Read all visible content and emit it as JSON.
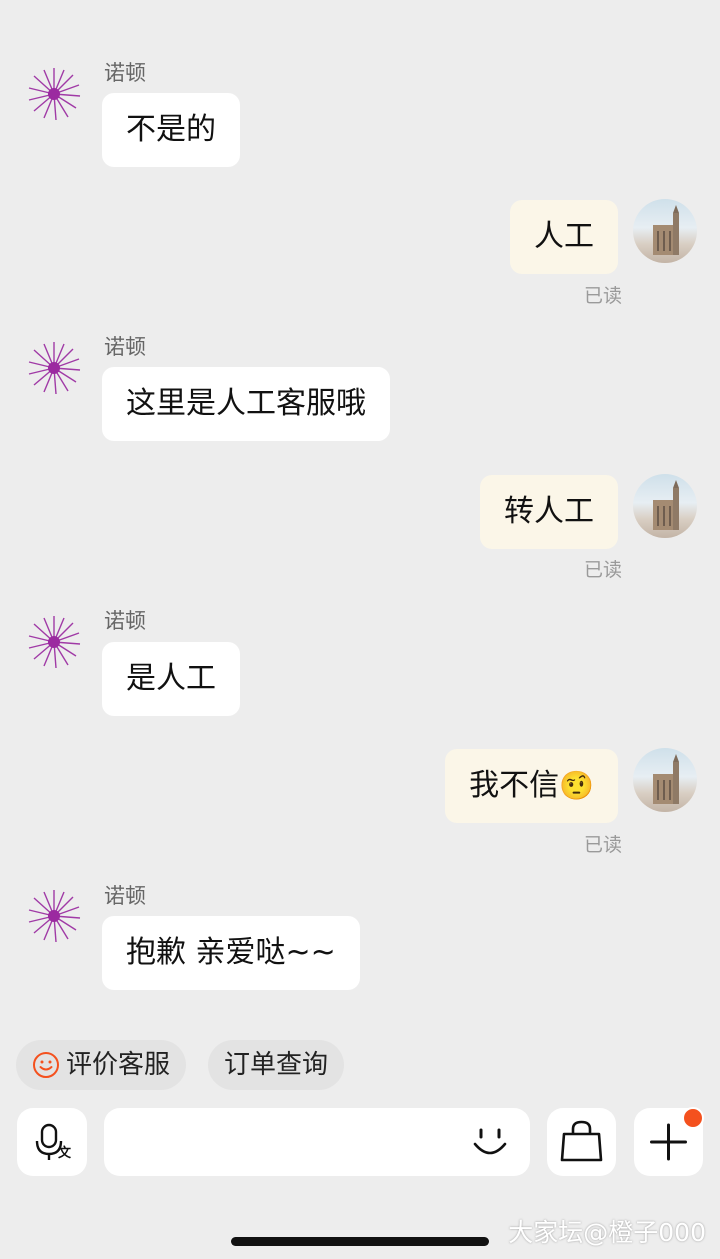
{
  "agent": {
    "name": "诺顿"
  },
  "read_label": "已读",
  "messages": {
    "m1": "不是的",
    "m2": "人工",
    "m3": "这里是人工客服哦",
    "m4": "转人工",
    "m5": "是人工",
    "m6": "我不信",
    "m6_emoji": "🤨",
    "m7": "抱歉 亲爱哒~~"
  },
  "quick_actions": {
    "rate": "评价客服",
    "order": "订单查询"
  },
  "input": {
    "placeholder": ""
  },
  "watermark": "大家坛@橙子000",
  "colors": {
    "accent": "#f4511e",
    "bubble_out": "#fbf6e8",
    "bubble_in": "#ffffff"
  }
}
